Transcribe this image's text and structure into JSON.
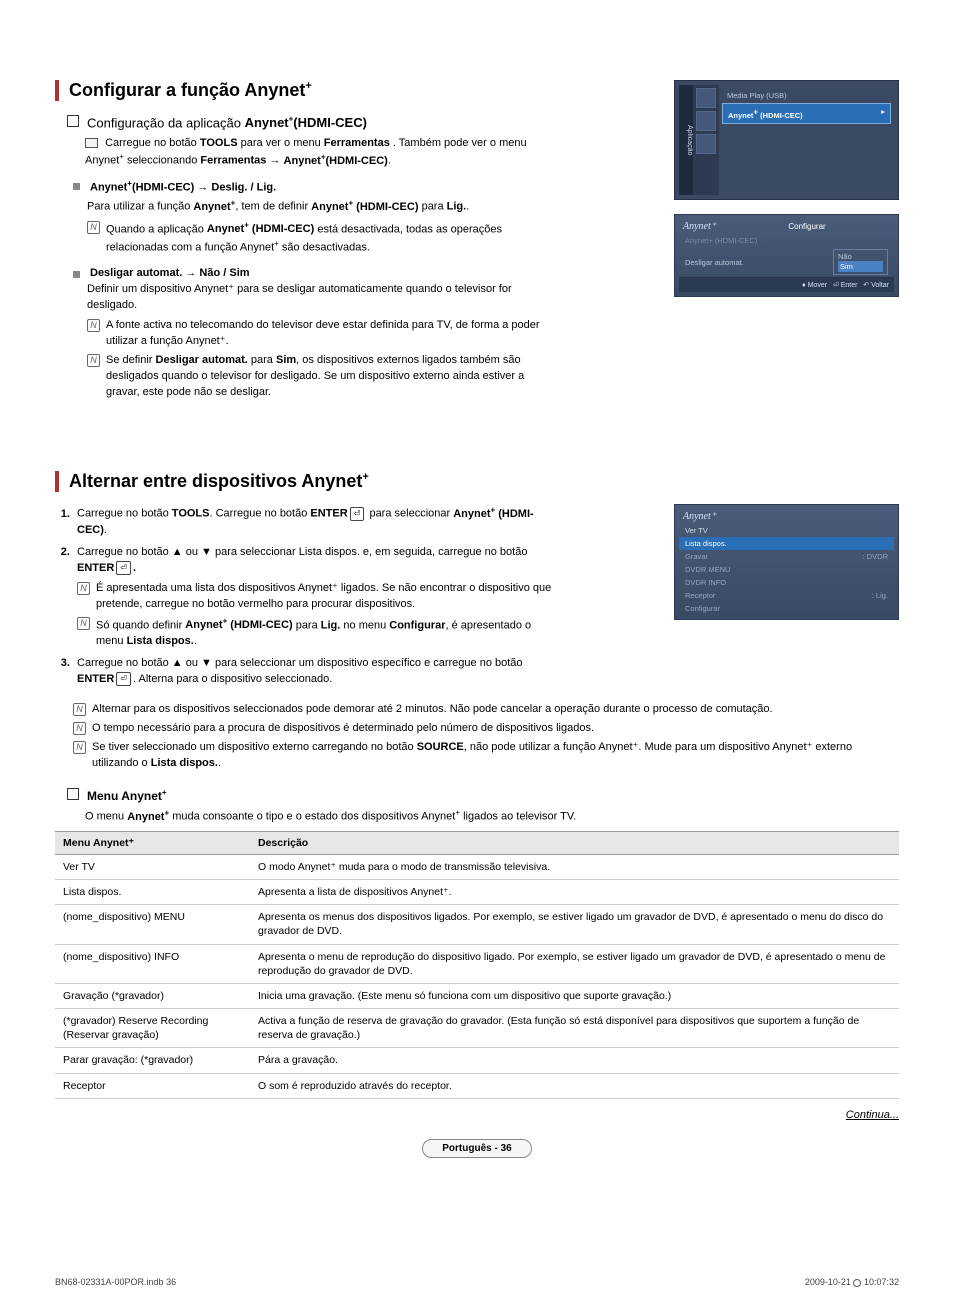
{
  "section1": {
    "title_pre": "Configurar a função Anynet",
    "title_sup": "+",
    "config_line_pre": "Configuração da aplicação ",
    "config_line_bold": "Anynet",
    "config_line_bold_sup": "+",
    "config_line_bold2": "(HDMI-CEC)",
    "tools_line_a": "Carregue no botão ",
    "tools_bold1": "TOOLS",
    "tools_line_b": " para ver o menu ",
    "tools_bold2": "Ferramentas",
    "tools_line_c": " . Também pode ver o menu Anynet",
    "tools_line_c_sup": "+",
    "tools_line_d": " seleccionando ",
    "tools_bold3": "Ferramentas",
    "tools_arrow": " → ",
    "tools_bold4": "Anynet",
    "tools_bold4_sup": "+",
    "tools_bold5": "(HDMI-CEC)",
    "tools_period": ".",
    "feat1_t1": "Anynet",
    "feat1_sup": "+",
    "feat1_t2": "(HDMI-CEC) → Deslig. / Lig.",
    "feat1_body_a": "Para utilizar a função ",
    "feat1_body_b": "Anynet",
    "feat1_body_sup": "+",
    "feat1_body_c": ", tem de definir ",
    "feat1_body_d": "Anynet",
    "feat1_body_d_sup": "+",
    "feat1_body_e": " (HDMI-CEC)",
    "feat1_body_f": " para ",
    "feat1_body_g": "Lig.",
    "feat1_body_h": ".",
    "feat1_note_a": "Quando a aplicação ",
    "feat1_note_b": "Anynet",
    "feat1_note_b_sup": "+",
    "feat1_note_c": " (HDMI-CEC)",
    "feat1_note_d": " está desactivada, todas as operações relacionadas com a função Anynet",
    "feat1_note_d_sup": "+",
    "feat1_note_e": " são desactivadas.",
    "feat2_t": "Desligar automat. → Não / Sim",
    "feat2_body": "Definir um dispositivo Anynet⁺ para se desligar automaticamente quando o televisor for desligado.",
    "feat2_note1": "A fonte activa no telecomando do televisor deve estar definida para TV, de forma a poder utilizar a função Anynet⁺.",
    "feat2_note2_a": "Se definir ",
    "feat2_note2_b": "Desligar automat.",
    "feat2_note2_c": " para ",
    "feat2_note2_d": "Sim",
    "feat2_note2_e": ", os dispositivos externos ligados também são desligados quando o televisor for desligado. Se um dispositivo externo ainda estiver a gravar, este pode não se desligar."
  },
  "osd1": {
    "vtab": "Aplicação",
    "item1": "Media Play (USB)",
    "item2_a": "Anynet",
    "item2_b": " (HDMI-CEC)"
  },
  "osd2": {
    "title": "Configurar",
    "brand": "Anynet⁺",
    "row1": "Anynet+ (HDMI-CEC)",
    "row2": "Desligar automat.",
    "val_no": "Não",
    "val_yes": "Sim",
    "foot_move": "Mover",
    "foot_enter": "Enter",
    "foot_back": "Voltar"
  },
  "section2": {
    "title_pre": "Alternar entre dispositivos Anynet",
    "title_sup": "+",
    "step1_a": "Carregue no botão ",
    "step1_b": "TOOLS",
    "step1_c": ". Carregue no botão ",
    "step1_d": "ENTER",
    "step1_e": " para seleccionar ",
    "step1_f": "Anynet",
    "step1_f_sup": "+",
    "step1_g": " (HDMI-CEC)",
    "step1_h": ".",
    "step2_a": "Carregue no botão ▲ ou ▼ para seleccionar Lista dispos. e, em seguida, carregue no botão ",
    "step2_b": "ENTER",
    "step2_c": ".",
    "step2_n1": "É apresentada uma lista dos dispositivos Anynet⁺ ligados. Se não encontrar o dispositivo que pretende, carregue no botão vermelho para procurar dispositivos.",
    "step2_n2_a": "Só quando definir ",
    "step2_n2_b": "Anynet",
    "step2_n2_b_sup": "+",
    "step2_n2_c": " (HDMI-CEC)",
    "step2_n2_d": " para ",
    "step2_n2_e": "Lig.",
    "step2_n2_f": " no menu ",
    "step2_n2_g": "Configurar",
    "step2_n2_h": ", é apresentado o menu ",
    "step2_n2_i": "Lista dispos.",
    "step2_n2_j": ".",
    "step3_a": "Carregue no botão ▲ ou ▼ para seleccionar um dispositivo específico e carregue no botão ",
    "step3_b": "ENTER",
    "step3_c": ". Alterna para o dispositivo seleccionado.",
    "gnote1": "Alternar para os dispositivos seleccionados pode demorar até 2 minutos. Não pode cancelar a operação durante o processo de comutação.",
    "gnote2": "O tempo necessário para a procura de dispositivos é determinado pelo número de dispositivos ligados.",
    "gnote3_a": "Se tiver seleccionado um dispositivo externo carregando no botão ",
    "gnote3_b": "SOURCE",
    "gnote3_c": ", não pode utilizar a função Anynet⁺. Mude para um dispositivo Anynet⁺ externo utilizando o ",
    "gnote3_d": "Lista dispos.",
    "gnote3_e": "."
  },
  "osd3": {
    "brand": "Anynet⁺",
    "r1": "Ver TV",
    "r2": "Lista dispos.",
    "r3": "Gravar",
    "r3v": ": DVDR",
    "r4": "DVDR MENU",
    "r5": "DVDR INFO",
    "r6": "Receptor",
    "r6v": ": Lig.",
    "r7": "Configurar"
  },
  "menu_sec": {
    "heading_a": "Menu Anynet",
    "heading_sup": "+",
    "intro_a": "O menu ",
    "intro_b": "Anynet",
    "intro_b_sup": "+",
    "intro_c": " muda consoante o tipo e o estado dos dispositivos Anynet",
    "intro_c_sup": "+",
    "intro_d": " ligados ao televisor TV."
  },
  "table": {
    "h1": "Menu Anynet⁺",
    "h2": "Descrição",
    "rows": [
      {
        "c1": "Ver TV",
        "c2": "O modo Anynet⁺ muda para o modo de transmissão televisiva."
      },
      {
        "c1": "Lista dispos.",
        "c2": "Apresenta a lista de dispositivos Anynet⁺."
      },
      {
        "c1": "(nome_dispositivo) MENU",
        "c2": "Apresenta os menus dos dispositivos ligados. Por exemplo, se estiver ligado um gravador de DVD, é apresentado o menu do disco do gravador de DVD."
      },
      {
        "c1": "(nome_dispositivo) INFO",
        "c2": "Apresenta o menu de reprodução do dispositivo ligado. Por exemplo, se estiver ligado um gravador de DVD, é apresentado o menu de reprodução do gravador de DVD."
      },
      {
        "c1": "Gravação (*gravador)",
        "c2": "Inicia uma gravação. (Este menu só funciona com um dispositivo que suporte gravação.)"
      },
      {
        "c1": "(*gravador) Reserve Recording (Reservar gravação)",
        "c2": "Activa a função de reserva de gravação do gravador. (Esta função só está disponível para dispositivos que suportem a função de reserva de gravação.)"
      },
      {
        "c1": "Parar gravação: (*gravador)",
        "c2": "Pára a gravação."
      },
      {
        "c1": "Receptor",
        "c2": "O som é reproduzido através do receptor."
      }
    ]
  },
  "cont": "Continua...",
  "lang_page": "Português - 36",
  "footer": {
    "left": "BN68-02331A-00POR.indb   36",
    "right_a": "2009-10-21   ",
    "right_b": "10:07:32"
  }
}
